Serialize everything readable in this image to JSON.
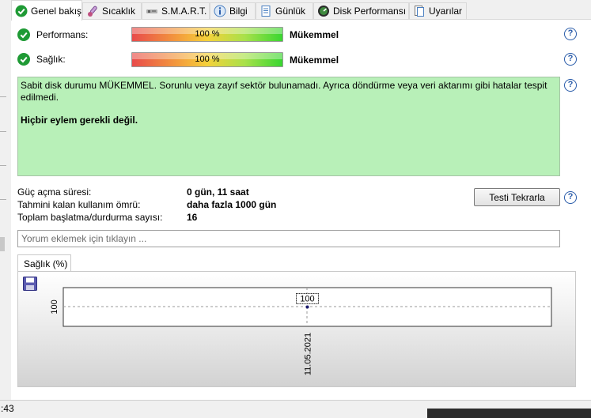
{
  "tabs": [
    {
      "label": "Genel bakış",
      "icon": "check-circle-icon"
    },
    {
      "label": "Sıcaklık",
      "icon": "thermometer-icon"
    },
    {
      "label": "S.M.A.R.T.",
      "icon": "smart-disk-icon"
    },
    {
      "label": "Bilgi",
      "icon": "info-icon"
    },
    {
      "label": "Günlük",
      "icon": "log-document-icon"
    },
    {
      "label": "Disk Performansı",
      "icon": "gauge-icon"
    },
    {
      "label": "Uyarılar",
      "icon": "alerts-icon"
    }
  ],
  "overview": {
    "performance": {
      "label": "Performans:",
      "percent_text": "100 %",
      "percent": 100,
      "rating": "Mükemmel"
    },
    "health": {
      "label": "Sağlık:",
      "percent_text": "100 %",
      "percent": 100,
      "rating": "Mükemmel"
    },
    "status_text": "Sabit disk durumu MÜKEMMEL. Sorunlu veya zayıf sektör bulunamadı. Ayrıca döndürme veya veri aktarımı gibi hatalar tespit edilmedi.",
    "status_action": "Hiçbir eylem gerekli değil.",
    "status_color": "#b8f0b8"
  },
  "info": {
    "power_on_label": "Güç açma süresi:",
    "power_on_value": "0 gün, 11 saat",
    "lifetime_label": "Tahmini kalan kullanım ömrü:",
    "lifetime_value": "daha fazla 1000 gün",
    "startstop_label": "Toplam başlatma/durdurma sayısı:",
    "startstop_value": "16",
    "retest_label": "Testi Tekrarla"
  },
  "comment": {
    "placeholder": "Yorum eklemek için tıklayın ..."
  },
  "chart_tab_label": "Sağlık (%)",
  "chart_data": {
    "type": "line",
    "x": [
      "11.05.2021"
    ],
    "series": [
      {
        "values": [
          100
        ]
      }
    ],
    "y_tick_labels": [
      "100"
    ],
    "data_labels": [
      "100"
    ],
    "grid": true
  },
  "statusbar": {
    "text": ":43"
  }
}
